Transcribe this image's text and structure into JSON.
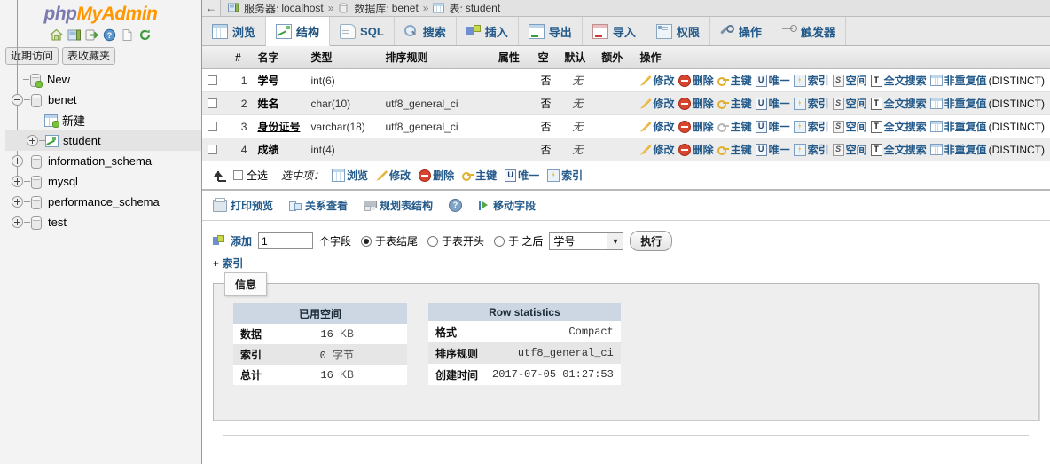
{
  "sidebar": {
    "logo": {
      "part1": "php",
      "part2": "MyAdmin"
    },
    "icons": [
      {
        "name": "home-icon",
        "glyph": "⌂"
      },
      {
        "name": "server-icon",
        "glyph": "▣"
      },
      {
        "name": "logout-icon",
        "glyph": "↪"
      },
      {
        "name": "help-icon",
        "glyph": "?"
      },
      {
        "name": "docs-icon",
        "glyph": "▧"
      },
      {
        "name": "refresh-icon",
        "glyph": "↻"
      }
    ],
    "quick_tabs": [
      {
        "label": "近期访问"
      },
      {
        "label": "表收藏夹"
      }
    ],
    "tree": [
      {
        "label": "New",
        "icon": "new-db-icon",
        "toggle": "none",
        "depth": 1,
        "selected": false
      },
      {
        "label": "benet",
        "icon": "db-icon",
        "toggle": "minus",
        "depth": 0,
        "selected": false
      },
      {
        "label": "新建",
        "icon": "new-table-icon",
        "toggle": "none",
        "depth": 2,
        "selected": false
      },
      {
        "label": "student",
        "icon": "table-structure-icon",
        "toggle": "plus",
        "depth": 1,
        "selected": true
      },
      {
        "label": "information_schema",
        "icon": "db-icon",
        "toggle": "plus",
        "depth": 0,
        "selected": false
      },
      {
        "label": "mysql",
        "icon": "db-icon",
        "toggle": "plus",
        "depth": 0,
        "selected": false
      },
      {
        "label": "performance_schema",
        "icon": "db-icon",
        "toggle": "plus",
        "depth": 0,
        "selected": false
      },
      {
        "label": "test",
        "icon": "db-icon",
        "toggle": "plus",
        "depth": 0,
        "selected": false
      }
    ]
  },
  "breadcrumb": {
    "back": "←",
    "server_label": "服务器:",
    "server_value": "localhost",
    "sep": "»",
    "db_label": "数据库:",
    "db_value": "benet",
    "table_label": "表:",
    "table_value": "student"
  },
  "tabs": [
    {
      "label": "浏览",
      "icon": "browse-icon",
      "active": false
    },
    {
      "label": "结构",
      "icon": "structure-icon",
      "active": true
    },
    {
      "label": "SQL",
      "icon": "sql-icon",
      "active": false
    },
    {
      "label": "搜索",
      "icon": "search-icon",
      "active": false
    },
    {
      "label": "插入",
      "icon": "insert-icon",
      "active": false
    },
    {
      "label": "导出",
      "icon": "export-icon",
      "active": false
    },
    {
      "label": "导入",
      "icon": "import-icon",
      "active": false
    },
    {
      "label": "权限",
      "icon": "privileges-icon",
      "active": false
    },
    {
      "label": "操作",
      "icon": "operations-icon",
      "active": false
    },
    {
      "label": "触发器",
      "icon": "triggers-icon",
      "active": false
    }
  ],
  "fields_table": {
    "headers": [
      "",
      "#",
      "名字",
      "类型",
      "排序规则",
      "属性",
      "空",
      "默认",
      "额外",
      "操作"
    ],
    "rows": [
      {
        "num": "1",
        "name": "学号",
        "underline": false,
        "type": "int(6)",
        "collation": "",
        "attributes": "",
        "null": "否",
        "default": "无",
        "extra": "",
        "key_dim": false
      },
      {
        "num": "2",
        "name": "姓名",
        "underline": false,
        "type": "char(10)",
        "collation": "utf8_general_ci",
        "attributes": "",
        "null": "否",
        "default": "无",
        "extra": "",
        "key_dim": false
      },
      {
        "num": "3",
        "name": "身份证号",
        "underline": true,
        "type": "varchar(18)",
        "collation": "utf8_general_ci",
        "attributes": "",
        "null": "否",
        "default": "无",
        "extra": "",
        "key_dim": true
      },
      {
        "num": "4",
        "name": "成绩",
        "underline": false,
        "type": "int(4)",
        "collation": "",
        "attributes": "",
        "null": "否",
        "default": "无",
        "extra": "",
        "key_dim": false
      }
    ],
    "row_actions": [
      {
        "name": "edit-action",
        "label": "修改",
        "icon": "pencil-icon"
      },
      {
        "name": "drop-action",
        "label": "删除",
        "icon": "delete-icon"
      },
      {
        "name": "primary-action",
        "label": "主键",
        "icon": "key-icon"
      },
      {
        "name": "unique-action",
        "label": "唯一",
        "icon": "unique-icon"
      },
      {
        "name": "index-action",
        "label": "索引",
        "icon": "index-icon"
      },
      {
        "name": "spatial-action",
        "label": "空间",
        "icon": "spatial-icon"
      },
      {
        "name": "fulltext-action",
        "label": "全文搜索",
        "icon": "fulltext-icon"
      },
      {
        "name": "distinct-action",
        "label": "非重复值",
        "suffix": "(DISTINCT)",
        "icon": "distinct-icon"
      }
    ]
  },
  "bulk_bar": {
    "select_all_label": "全选",
    "with_selected_label": "选中项：",
    "actions": [
      {
        "name": "bulk-browse",
        "label": "浏览",
        "icon": "browse-icon"
      },
      {
        "name": "bulk-edit",
        "label": "修改",
        "icon": "pencil-icon"
      },
      {
        "name": "bulk-drop",
        "label": "删除",
        "icon": "delete-icon"
      },
      {
        "name": "bulk-primary",
        "label": "主键",
        "icon": "key-icon"
      },
      {
        "name": "bulk-unique",
        "label": "唯一",
        "icon": "unique-icon"
      },
      {
        "name": "bulk-index",
        "label": "索引",
        "icon": "index-icon"
      }
    ]
  },
  "toolbar2": [
    {
      "name": "print-view",
      "label": "打印预览",
      "icon": "printer-icon"
    },
    {
      "name": "relation-view",
      "label": "关系查看",
      "icon": "relation-icon"
    },
    {
      "name": "propose-structure",
      "label": "规划表结构",
      "icon": "planner-icon"
    },
    {
      "name": "help",
      "label": "",
      "icon": "help-icon"
    },
    {
      "name": "move-columns",
      "label": "移动字段",
      "icon": "move-icon"
    }
  ],
  "add_form": {
    "add_label": "添加",
    "count_value": "1",
    "fields_label": "个字段",
    "options": [
      {
        "label": "于表结尾",
        "selected": true
      },
      {
        "label": "于表开头",
        "selected": false
      },
      {
        "label": "于 之后",
        "selected": false
      }
    ],
    "after_column": "学号",
    "go_label": "执行",
    "index_plus": "+",
    "index_label": "索引"
  },
  "info_panel": {
    "legend": "信息",
    "space_table": {
      "caption": "已用空间",
      "rows": [
        {
          "key": "数据",
          "value": "16",
          "unit": "KB"
        },
        {
          "key": "索引",
          "value": "0",
          "unit": "字节"
        },
        {
          "key": "总计",
          "value": "16",
          "unit": "KB"
        }
      ]
    },
    "row_stats": {
      "caption": "Row statistics",
      "rows": [
        {
          "key": "格式",
          "value": "Compact"
        },
        {
          "key": "排序规则",
          "value": "utf8_general_ci"
        },
        {
          "key": "创建时间",
          "value": "2017-07-05 01:27:53"
        }
      ]
    }
  },
  "colors": {
    "logo_purple": "#7a7ab0",
    "logo_orange": "#ff9800",
    "link_blue": "#235a8a",
    "row_alt": "#ececec",
    "caption_blue": "#ccd7e3"
  }
}
